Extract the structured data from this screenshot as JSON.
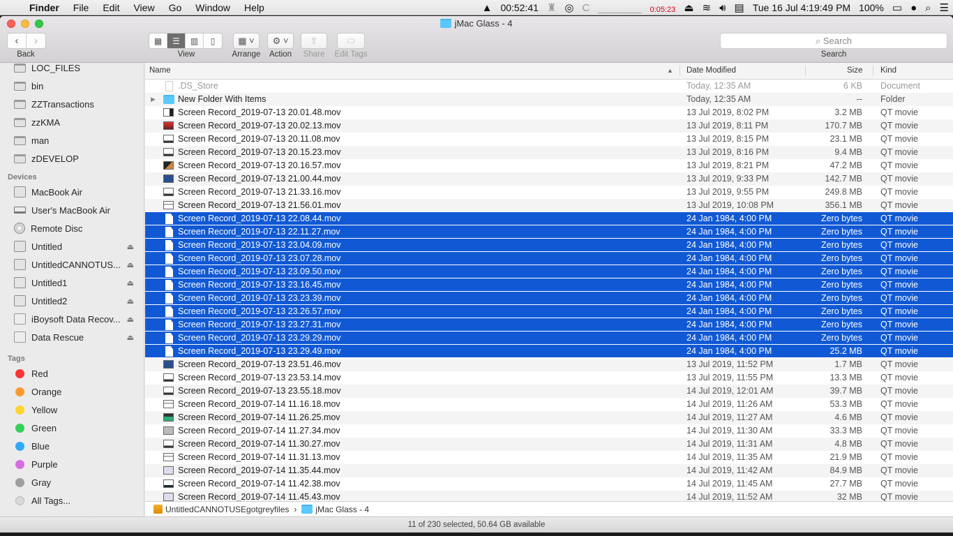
{
  "menubar": {
    "apple": "",
    "app": "Finder",
    "items": [
      "File",
      "Edit",
      "View",
      "Go",
      "Window",
      "Help"
    ],
    "status": {
      "vlc_time": "00:52:41",
      "timer": "0:05:23",
      "datetime": "Tue 16 Jul  4:19:49 PM",
      "battery": "100%"
    }
  },
  "window": {
    "title": "jMac Glass - 4",
    "toolbar": {
      "back_label": "Back",
      "view_label": "View",
      "arrange_label": "Arrange",
      "action_label": "Action",
      "share_label": "Share",
      "edit_tags_label": "Edit Tags",
      "search_placeholder": "Search",
      "search_label": "Search"
    }
  },
  "sidebar": {
    "favorites": [
      "LOC_FILES",
      "bin",
      "ZZTransactions",
      "zzKMA",
      "man",
      "zDEVELOP"
    ],
    "devices_header": "Devices",
    "devices": [
      {
        "label": "MacBook Air",
        "icon": "internal-disk",
        "eject": false
      },
      {
        "label": "User's MacBook Air",
        "icon": "laptop",
        "eject": false
      },
      {
        "label": "Remote Disc",
        "icon": "disc",
        "eject": false
      },
      {
        "label": "Untitled",
        "icon": "internal-disk",
        "eject": true
      },
      {
        "label": "UntitledCANNOTUS...",
        "icon": "internal-disk",
        "eject": true
      },
      {
        "label": "Untitled1",
        "icon": "internal-disk",
        "eject": true
      },
      {
        "label": "Untitled2",
        "icon": "internal-disk",
        "eject": true
      },
      {
        "label": "iBoysoft Data Recov...",
        "icon": "external-disk",
        "eject": true
      },
      {
        "label": "Data Rescue",
        "icon": "external-disk",
        "eject": true
      }
    ],
    "tags_header": "Tags",
    "tags": [
      {
        "label": "Red",
        "color": "#fc3535"
      },
      {
        "label": "Orange",
        "color": "#fd9a2e"
      },
      {
        "label": "Yellow",
        "color": "#fcd530"
      },
      {
        "label": "Green",
        "color": "#34d158"
      },
      {
        "label": "Blue",
        "color": "#30aaf8"
      },
      {
        "label": "Purple",
        "color": "#d66ee0"
      },
      {
        "label": "Gray",
        "color": "#9e9e9e"
      },
      {
        "label": "All Tags...",
        "color": "#d8d8d8"
      }
    ]
  },
  "columns": {
    "name": "Name",
    "date": "Date Modified",
    "size": "Size",
    "kind": "Kind"
  },
  "files": [
    {
      "name": ".DS_Store",
      "date": "Today, 12:35 AM",
      "size": "6 KB",
      "kind": "Document",
      "icon": "doc",
      "dim": true
    },
    {
      "name": "New Folder With Items",
      "date": "Today, 12:35 AM",
      "size": "--",
      "kind": "Folder",
      "icon": "folder",
      "folder": true
    },
    {
      "name": "Screen Record_2019-07-13 20.01.48.mov",
      "date": "13 Jul 2019, 8:02 PM",
      "size": "3.2 MB",
      "kind": "QT movie",
      "icon": "v1"
    },
    {
      "name": "Screen Record_2019-07-13 20.02.13.mov",
      "date": "13 Jul 2019, 8:11 PM",
      "size": "170.7 MB",
      "kind": "QT movie",
      "icon": "v2"
    },
    {
      "name": "Screen Record_2019-07-13 20.11.08.mov",
      "date": "13 Jul 2019, 8:15 PM",
      "size": "23.1 MB",
      "kind": "QT movie",
      "icon": "v3"
    },
    {
      "name": "Screen Record_2019-07-13 20.15.23.mov",
      "date": "13 Jul 2019, 8:16 PM",
      "size": "9.4 MB",
      "kind": "QT movie",
      "icon": "v3"
    },
    {
      "name": "Screen Record_2019-07-13 20.16.57.mov",
      "date": "13 Jul 2019, 8:21 PM",
      "size": "47.2 MB",
      "kind": "QT movie",
      "icon": "v4"
    },
    {
      "name": "Screen Record_2019-07-13 21.00.44.mov",
      "date": "13 Jul 2019, 9:33 PM",
      "size": "142.7 MB",
      "kind": "QT movie",
      "icon": "v5"
    },
    {
      "name": "Screen Record_2019-07-13 21.33.16.mov",
      "date": "13 Jul 2019, 9:55 PM",
      "size": "249.8 MB",
      "kind": "QT movie",
      "icon": "v3"
    },
    {
      "name": "Screen Record_2019-07-13 21.56.01.mov",
      "date": "13 Jul 2019, 10:08 PM",
      "size": "356.1 MB",
      "kind": "QT movie",
      "icon": "v6"
    },
    {
      "name": "Screen Record_2019-07-13 22.08.44.mov",
      "date": "24 Jan 1984, 4:00 PM",
      "size": "Zero bytes",
      "kind": "QT movie",
      "icon": "blank",
      "selected": true
    },
    {
      "name": "Screen Record_2019-07-13 22.11.27.mov",
      "date": "24 Jan 1984, 4:00 PM",
      "size": "Zero bytes",
      "kind": "QT movie",
      "icon": "blank",
      "selected": true
    },
    {
      "name": "Screen Record_2019-07-13 23.04.09.mov",
      "date": "24 Jan 1984, 4:00 PM",
      "size": "Zero bytes",
      "kind": "QT movie",
      "icon": "blank",
      "selected": true
    },
    {
      "name": "Screen Record_2019-07-13 23.07.28.mov",
      "date": "24 Jan 1984, 4:00 PM",
      "size": "Zero bytes",
      "kind": "QT movie",
      "icon": "blank",
      "selected": true
    },
    {
      "name": "Screen Record_2019-07-13 23.09.50.mov",
      "date": "24 Jan 1984, 4:00 PM",
      "size": "Zero bytes",
      "kind": "QT movie",
      "icon": "blank",
      "selected": true
    },
    {
      "name": "Screen Record_2019-07-13 23.16.45.mov",
      "date": "24 Jan 1984, 4:00 PM",
      "size": "Zero bytes",
      "kind": "QT movie",
      "icon": "blank",
      "selected": true
    },
    {
      "name": "Screen Record_2019-07-13 23.23.39.mov",
      "date": "24 Jan 1984, 4:00 PM",
      "size": "Zero bytes",
      "kind": "QT movie",
      "icon": "blank",
      "selected": true
    },
    {
      "name": "Screen Record_2019-07-13 23.26.57.mov",
      "date": "24 Jan 1984, 4:00 PM",
      "size": "Zero bytes",
      "kind": "QT movie",
      "icon": "blank",
      "selected": true
    },
    {
      "name": "Screen Record_2019-07-13 23.27.31.mov",
      "date": "24 Jan 1984, 4:00 PM",
      "size": "Zero bytes",
      "kind": "QT movie",
      "icon": "blank",
      "selected": true
    },
    {
      "name": "Screen Record_2019-07-13 23.29.29.mov",
      "date": "24 Jan 1984, 4:00 PM",
      "size": "Zero bytes",
      "kind": "QT movie",
      "icon": "blank",
      "selected": true
    },
    {
      "name": "Screen Record_2019-07-13 23.29.49.mov",
      "date": "24 Jan 1984, 4:00 PM",
      "size": "25.2 MB",
      "kind": "QT movie",
      "icon": "blank",
      "selected": true
    },
    {
      "name": "Screen Record_2019-07-13 23.51.46.mov",
      "date": "13 Jul 2019, 11:52 PM",
      "size": "1.7 MB",
      "kind": "QT movie",
      "icon": "v5"
    },
    {
      "name": "Screen Record_2019-07-13 23.53.14.mov",
      "date": "13 Jul 2019, 11:55 PM",
      "size": "13.3 MB",
      "kind": "QT movie",
      "icon": "v3"
    },
    {
      "name": "Screen Record_2019-07-13 23.55.18.mov",
      "date": "14 Jul 2019, 12:01 AM",
      "size": "39.7 MB",
      "kind": "QT movie",
      "icon": "v3"
    },
    {
      "name": "Screen Record_2019-07-14 11.16.18.mov",
      "date": "14 Jul 2019, 11:26 AM",
      "size": "53.3 MB",
      "kind": "QT movie",
      "icon": "v6"
    },
    {
      "name": "Screen Record_2019-07-14 11.26.25.mov",
      "date": "14 Jul 2019, 11:27 AM",
      "size": "4.6 MB",
      "kind": "QT movie",
      "icon": "v7"
    },
    {
      "name": "Screen Record_2019-07-14 11.27.34.mov",
      "date": "14 Jul 2019, 11:30 AM",
      "size": "33.3 MB",
      "kind": "QT movie",
      "icon": "v8"
    },
    {
      "name": "Screen Record_2019-07-14 11.30.27.mov",
      "date": "14 Jul 2019, 11:31 AM",
      "size": "4.8 MB",
      "kind": "QT movie",
      "icon": "v3"
    },
    {
      "name": "Screen Record_2019-07-14 11.31.13.mov",
      "date": "14 Jul 2019, 11:35 AM",
      "size": "21.9 MB",
      "kind": "QT movie",
      "icon": "v6"
    },
    {
      "name": "Screen Record_2019-07-14 11.35.44.mov",
      "date": "14 Jul 2019, 11:42 AM",
      "size": "84.9 MB",
      "kind": "QT movie",
      "icon": "v10"
    },
    {
      "name": "Screen Record_2019-07-14 11.42.38.mov",
      "date": "14 Jul 2019, 11:45 AM",
      "size": "27.7 MB",
      "kind": "QT movie",
      "icon": "v9"
    },
    {
      "name": "Screen Record_2019-07-14 11.45.43.mov",
      "date": "14 Jul 2019, 11:52 AM",
      "size": "32 MB",
      "kind": "QT movie",
      "icon": "v10"
    }
  ],
  "pathbar": {
    "drive": "UntitledCANNOTUSEgotgreyfiles",
    "separator": "›",
    "folder": "jMac Glass - 4"
  },
  "statusbar": {
    "text": "11 of 230 selected, 50.64 GB available"
  }
}
